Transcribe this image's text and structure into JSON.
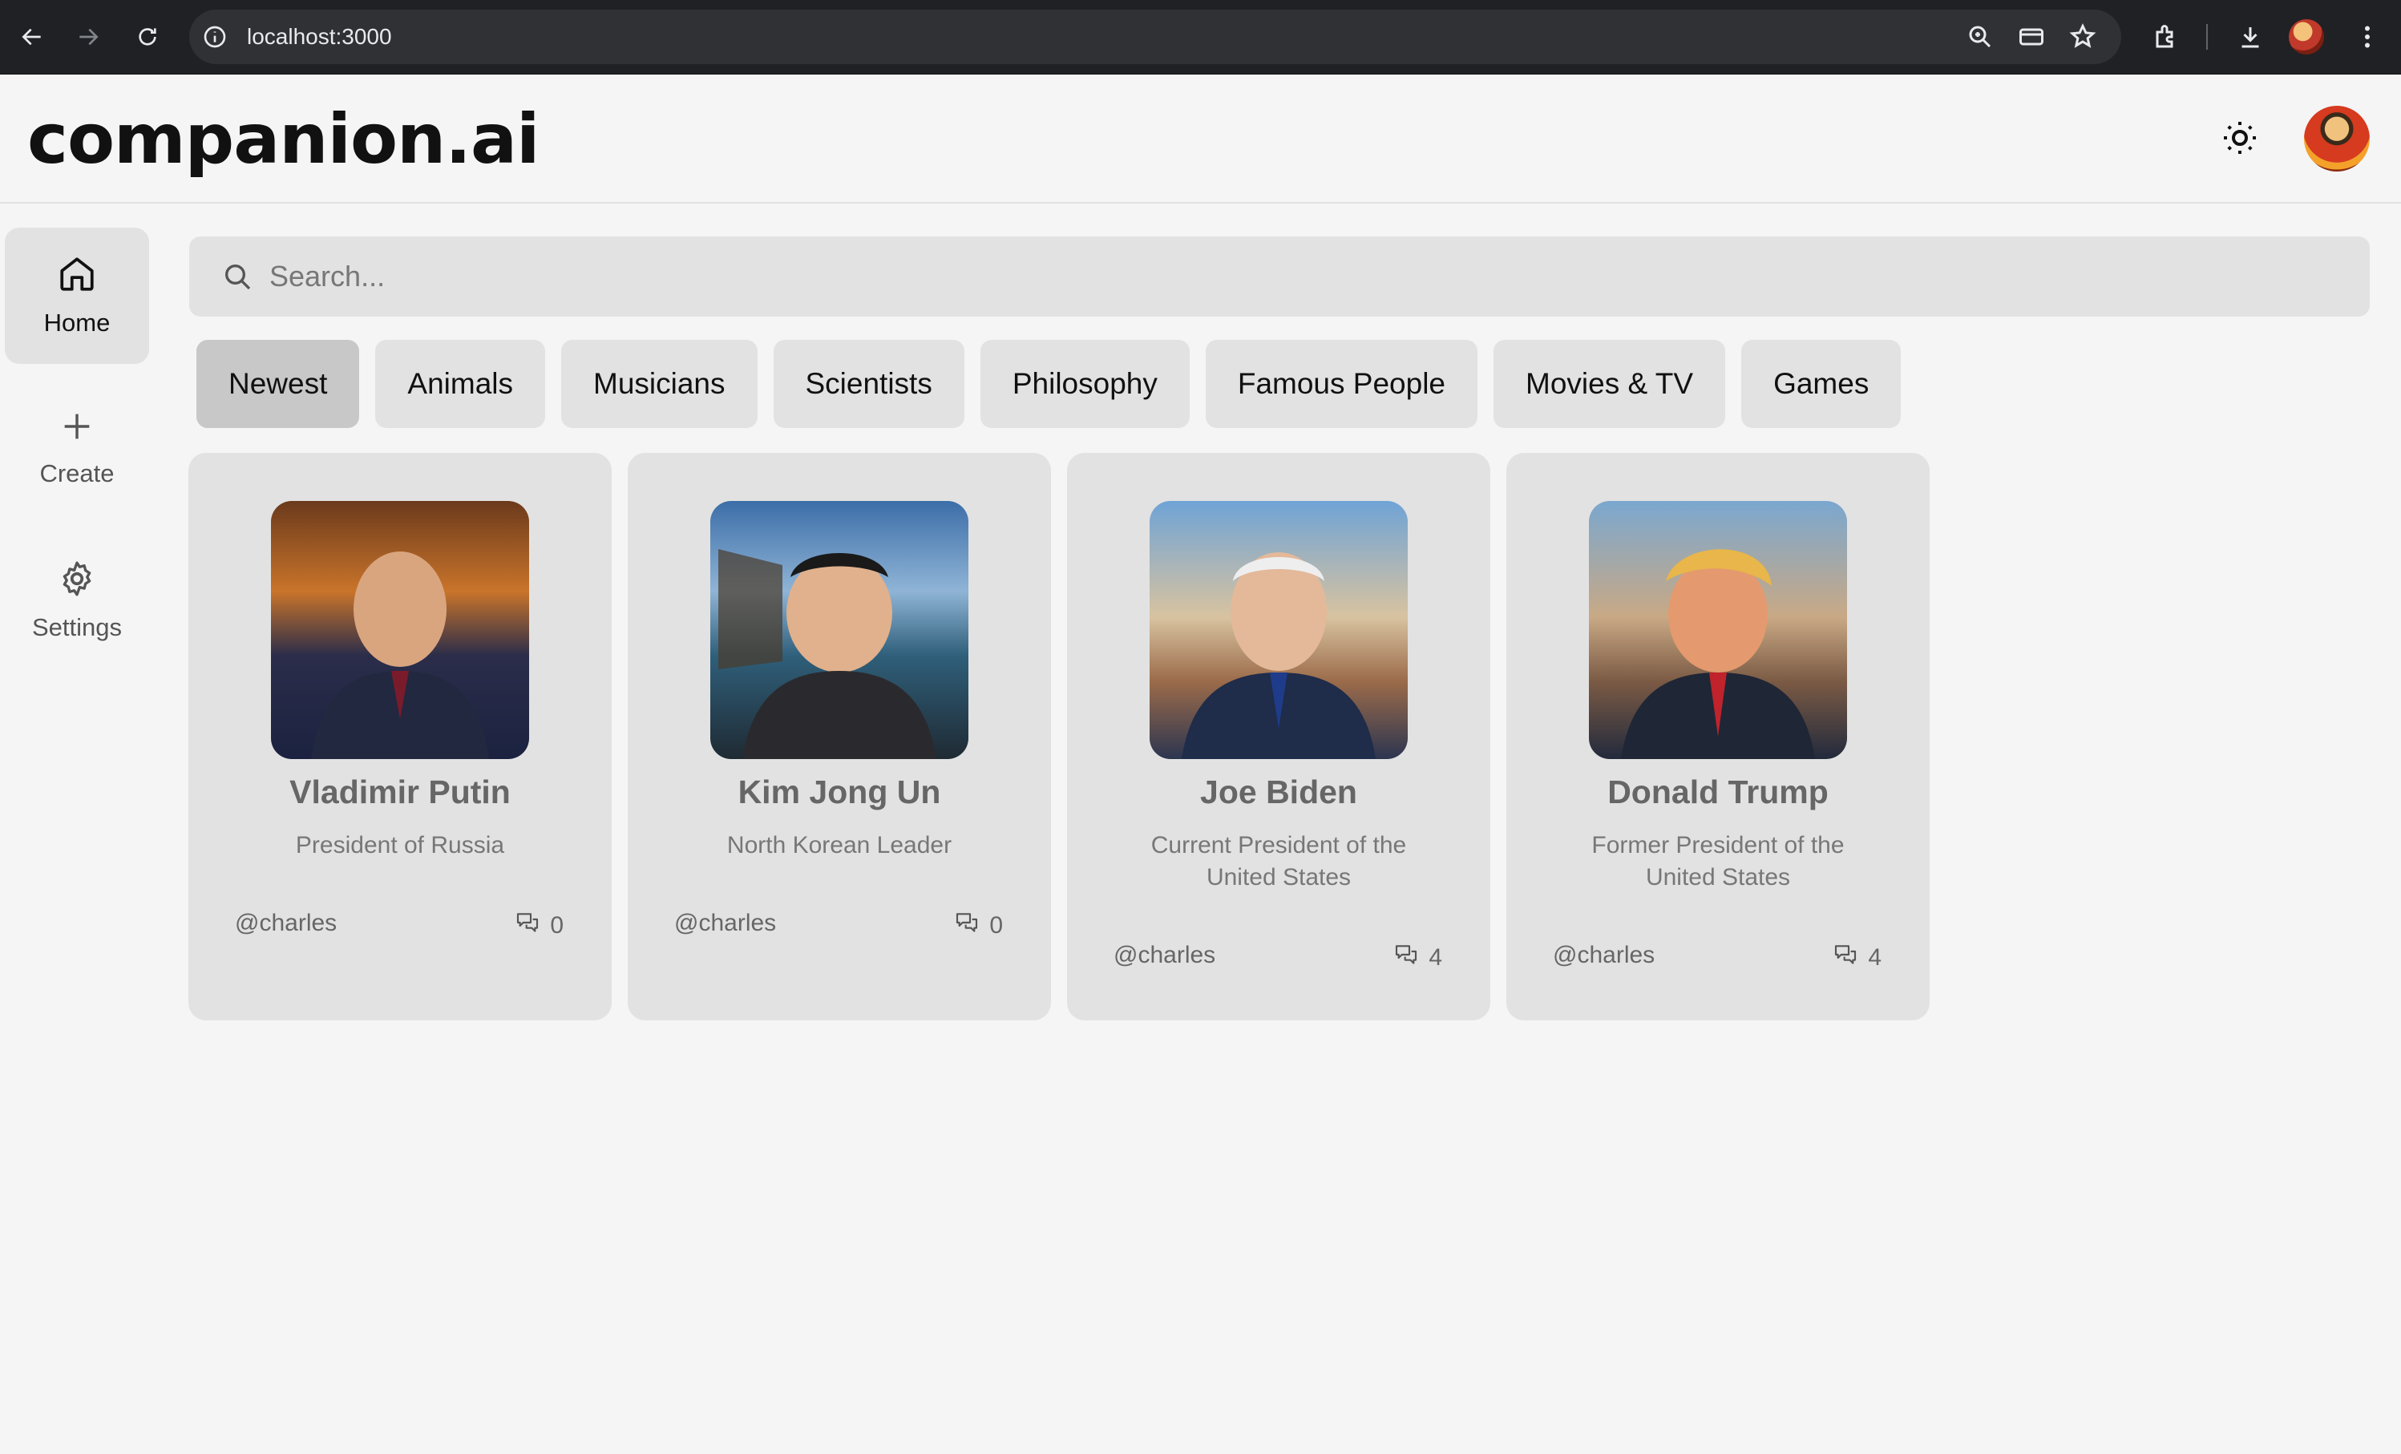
{
  "browser": {
    "url": "localhost:3000",
    "icons": [
      "back-arrow-icon",
      "forward-arrow-icon",
      "reload-icon",
      "site-info-icon",
      "zoom-icon",
      "card-icon",
      "bookmark-star-icon",
      "extensions-icon",
      "download-icon",
      "profile-avatar",
      "menu-kebab-icon"
    ]
  },
  "header": {
    "brand": "companion.ai",
    "theme_icon": "sun-icon"
  },
  "sidebar": {
    "items": [
      {
        "label": "Home",
        "icon": "home-icon",
        "active": true
      },
      {
        "label": "Create",
        "icon": "plus-icon",
        "active": false
      },
      {
        "label": "Settings",
        "icon": "gear-icon",
        "active": false
      }
    ]
  },
  "search": {
    "placeholder": "Search...",
    "value": ""
  },
  "categories": [
    {
      "label": "Newest",
      "active": true
    },
    {
      "label": "Animals",
      "active": false
    },
    {
      "label": "Musicians",
      "active": false
    },
    {
      "label": "Scientists",
      "active": false
    },
    {
      "label": "Philosophy",
      "active": false
    },
    {
      "label": "Famous People",
      "active": false
    },
    {
      "label": "Movies & TV",
      "active": false
    },
    {
      "label": "Games",
      "active": false
    }
  ],
  "companions": [
    {
      "name": "Vladimir Putin",
      "description": "President of Russia",
      "handle": "@charles",
      "messages": "0"
    },
    {
      "name": "Kim Jong Un",
      "description": "North Korean Leader",
      "handle": "@charles",
      "messages": "0"
    },
    {
      "name": "Joe Biden",
      "description": "Current President of the United States",
      "handle": "@charles",
      "messages": "4"
    },
    {
      "name": "Donald Trump",
      "description": "Former President of the United States",
      "handle": "@charles",
      "messages": "4"
    }
  ],
  "colors": {
    "page_bg": "#f5f5f5",
    "surface": "#e2e2e2",
    "active_chip": "#c8c8c8",
    "browser_bar": "#202124"
  }
}
